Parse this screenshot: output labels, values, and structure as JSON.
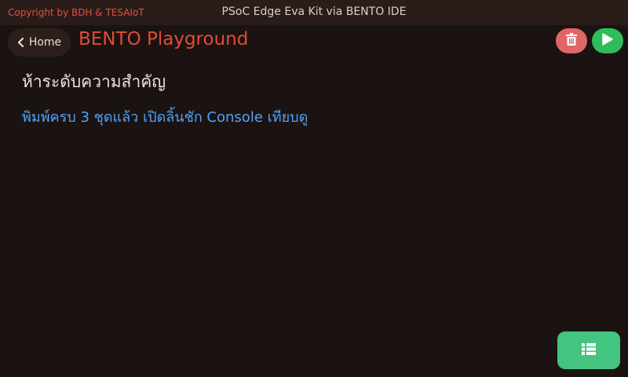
{
  "header": {
    "copyright": "Copyright by BDH & TESAIoT",
    "title": "PSoC Edge Eva Kit via BENTO IDE"
  },
  "nav": {
    "home_label": "Home",
    "home_icon": "chevron-left-icon"
  },
  "page": {
    "title": "BENTO Playground"
  },
  "toolbar": {
    "delete_icon": "trash-icon",
    "run_icon": "play-icon"
  },
  "content": {
    "heading": "ห้าระดับความสำคัญ",
    "message": "พิมพ์ครบ 3 ชุดแล้ว เปิดลิ้นชัก Console เทียบดู"
  },
  "footer": {
    "list_icon": "list-icon"
  },
  "colors": {
    "background": "#1b1312",
    "topbar": "#2a1c19",
    "accent_red": "#e24c36",
    "delete": "#e06666",
    "run": "#2fbd5a",
    "list": "#43c47f",
    "message_blue": "#4fa3f7"
  }
}
